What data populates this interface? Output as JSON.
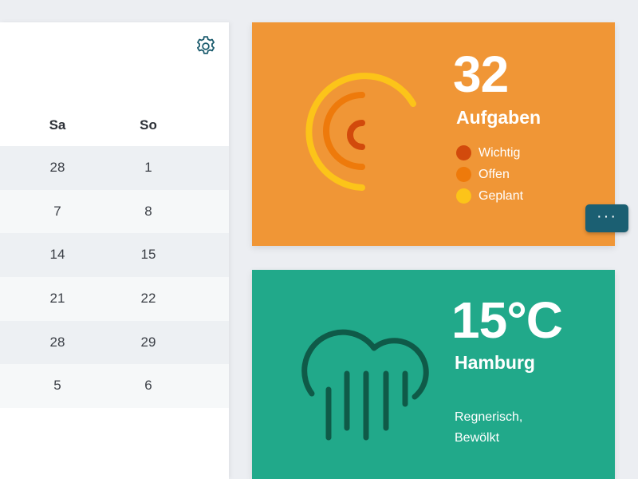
{
  "calendar": {
    "headers": [
      "Sa",
      "So"
    ],
    "rows": [
      [
        "28",
        "1"
      ],
      [
        "7",
        "8"
      ],
      [
        "14",
        "15"
      ],
      [
        "21",
        "22"
      ],
      [
        "28",
        "29"
      ],
      [
        "5",
        "6"
      ]
    ],
    "settings_icon": "gear-icon"
  },
  "tasks": {
    "count": "32",
    "label": "Aufgaben",
    "legend": [
      {
        "label": "Wichtig",
        "color": "#d24a0c"
      },
      {
        "label": "Offen",
        "color": "#ee7a0b"
      },
      {
        "label": "Geplant",
        "color": "#fcc419"
      }
    ],
    "background": "#f09636",
    "more_label": "···"
  },
  "weather": {
    "temperature": "15°C",
    "city": "Hamburg",
    "condition_line1": "Regnerisch,",
    "condition_line2": "Bewölkt",
    "icon": "cloud-rain-icon",
    "background": "#21a98a"
  }
}
